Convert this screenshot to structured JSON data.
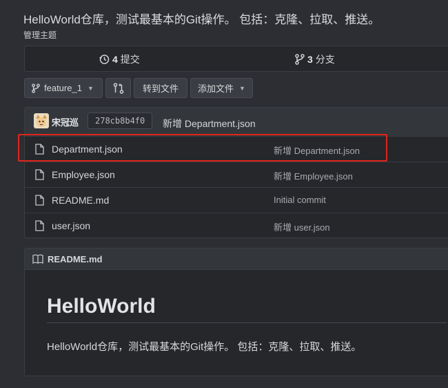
{
  "repo": {
    "description": "HelloWorld仓库，测试最基本的Git操作。 包括：克隆、拉取、推送。",
    "manage_topics": "管理主题"
  },
  "stats": {
    "commits_count": "4",
    "commits_label": "提交",
    "branches_count": "3",
    "branches_label": "分支"
  },
  "toolbar": {
    "branch": "feature_1",
    "goto_file": "转到文件",
    "add_file": "添加文件"
  },
  "latest_commit": {
    "author": "宋冠巡",
    "sha": "278cb8b4f0",
    "message": "新增 Department.json"
  },
  "files": [
    {
      "name": "Department.json",
      "message": "新增 Department.json"
    },
    {
      "name": "Employee.json",
      "message": "新增 Employee.json"
    },
    {
      "name": "README.md",
      "message": "Initial commit"
    },
    {
      "name": "user.json",
      "message": "新增 user.json"
    }
  ],
  "readme": {
    "filename": "README.md",
    "title": "HelloWorld",
    "body": "HelloWorld仓库，测试最基本的Git操作。 包括：克隆、拉取、推送。"
  },
  "colors": {
    "background": "#2c2e33",
    "highlight": "#e0251c"
  },
  "icons": [
    "history-icon",
    "branch-icon",
    "compare-icon",
    "file-icon",
    "book-icon",
    "caret-down-icon"
  ]
}
